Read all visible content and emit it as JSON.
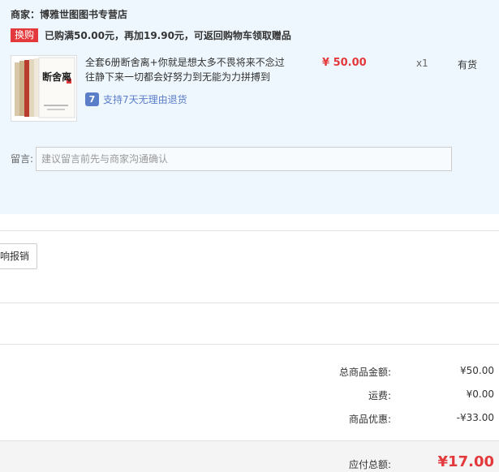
{
  "seller": {
    "label": "商家：",
    "name": "博雅世图图书专营店"
  },
  "promo": {
    "tag": "换购",
    "text": "已购满50.00元，再加19.90元，可返回购物车领取赠品"
  },
  "item": {
    "title": "全套6册断舍离+你就是想太多不畏将来不念过往静下来一切都会好努力到无能为力拼搏到",
    "cover_text": "断舍离",
    "return_icon": "7",
    "return_policy": "支持7天无理由退货",
    "price": "¥ 50.00",
    "quantity": "x1",
    "stock": "有货"
  },
  "note": {
    "label": "留言:",
    "placeholder": "建议留言前先与商家沟通确认"
  },
  "invoice": {
    "button_label": "响报销"
  },
  "summary": {
    "goods_total_label": "总商品金额:",
    "goods_total_value": "¥50.00",
    "shipping_label": "运费:",
    "shipping_value": "¥0.00",
    "discount_label": "商品优惠:",
    "discount_value": "-¥33.00",
    "payable_label": "应付总额:",
    "payable_value": "¥17.00"
  },
  "colors": {
    "accent": "#e4393c",
    "panel_bg": "#eef7fd",
    "link_blue": "#5b7ec9"
  }
}
